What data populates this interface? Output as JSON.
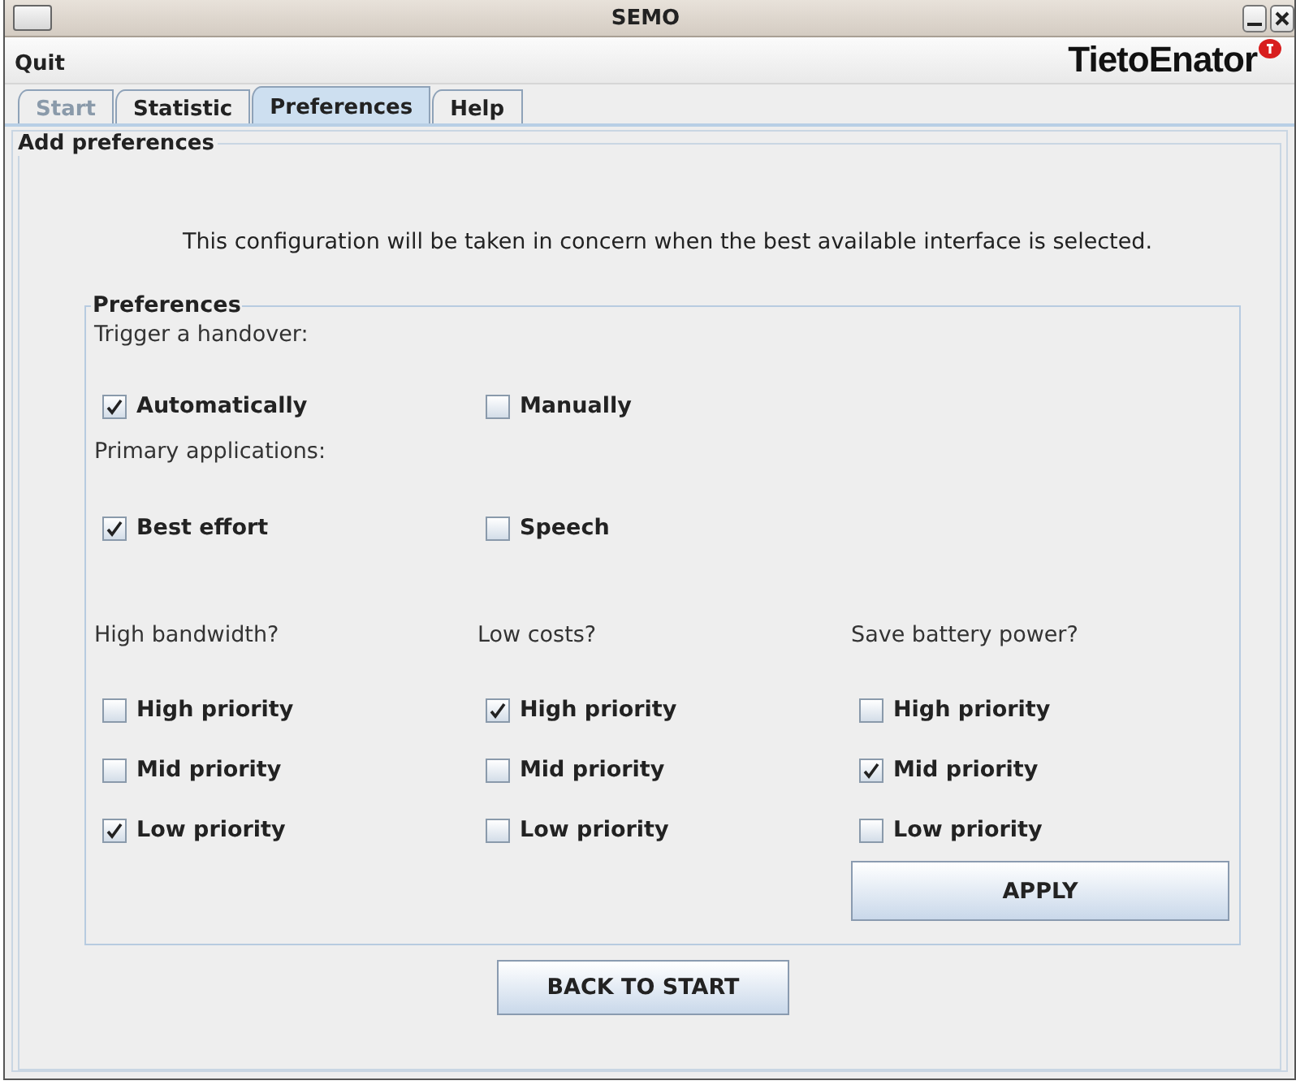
{
  "window": {
    "title": "SEMO"
  },
  "menu": [
    {
      "label": "Quit"
    }
  ],
  "logo": "TietoEnator",
  "tabs": [
    {
      "label": "Start",
      "selected": false,
      "disabled": true
    },
    {
      "label": "Statistic",
      "selected": false,
      "disabled": false
    },
    {
      "label": "Preferences",
      "selected": true,
      "disabled": false
    },
    {
      "label": "Help",
      "selected": false,
      "disabled": false
    }
  ],
  "section_title": "Add preferences",
  "description": "This configuration will be taken in concern when the best available interface is selected.",
  "group": {
    "title": "Preferences",
    "handover": {
      "label": "Trigger a handover:",
      "options": [
        {
          "label": "Automatically",
          "checked": true
        },
        {
          "label": "Manually",
          "checked": false
        }
      ]
    },
    "applications": {
      "label": "Primary applications:",
      "options": [
        {
          "label": "Best effort",
          "checked": true
        },
        {
          "label": "Speech",
          "checked": false
        }
      ]
    },
    "criteria": [
      {
        "label": "High bandwidth?",
        "options": [
          {
            "label": "High priority",
            "checked": false
          },
          {
            "label": "Mid priority",
            "checked": false
          },
          {
            "label": "Low priority",
            "checked": true
          }
        ]
      },
      {
        "label": "Low costs?",
        "options": [
          {
            "label": "High priority",
            "checked": true
          },
          {
            "label": "Mid priority",
            "checked": false
          },
          {
            "label": "Low priority",
            "checked": false
          }
        ]
      },
      {
        "label": "Save battery power?",
        "options": [
          {
            "label": "High priority",
            "checked": false
          },
          {
            "label": "Mid priority",
            "checked": true
          },
          {
            "label": "Low priority",
            "checked": false
          }
        ]
      }
    ],
    "apply_button": "APPLY"
  },
  "back_button": "BACK TO START"
}
